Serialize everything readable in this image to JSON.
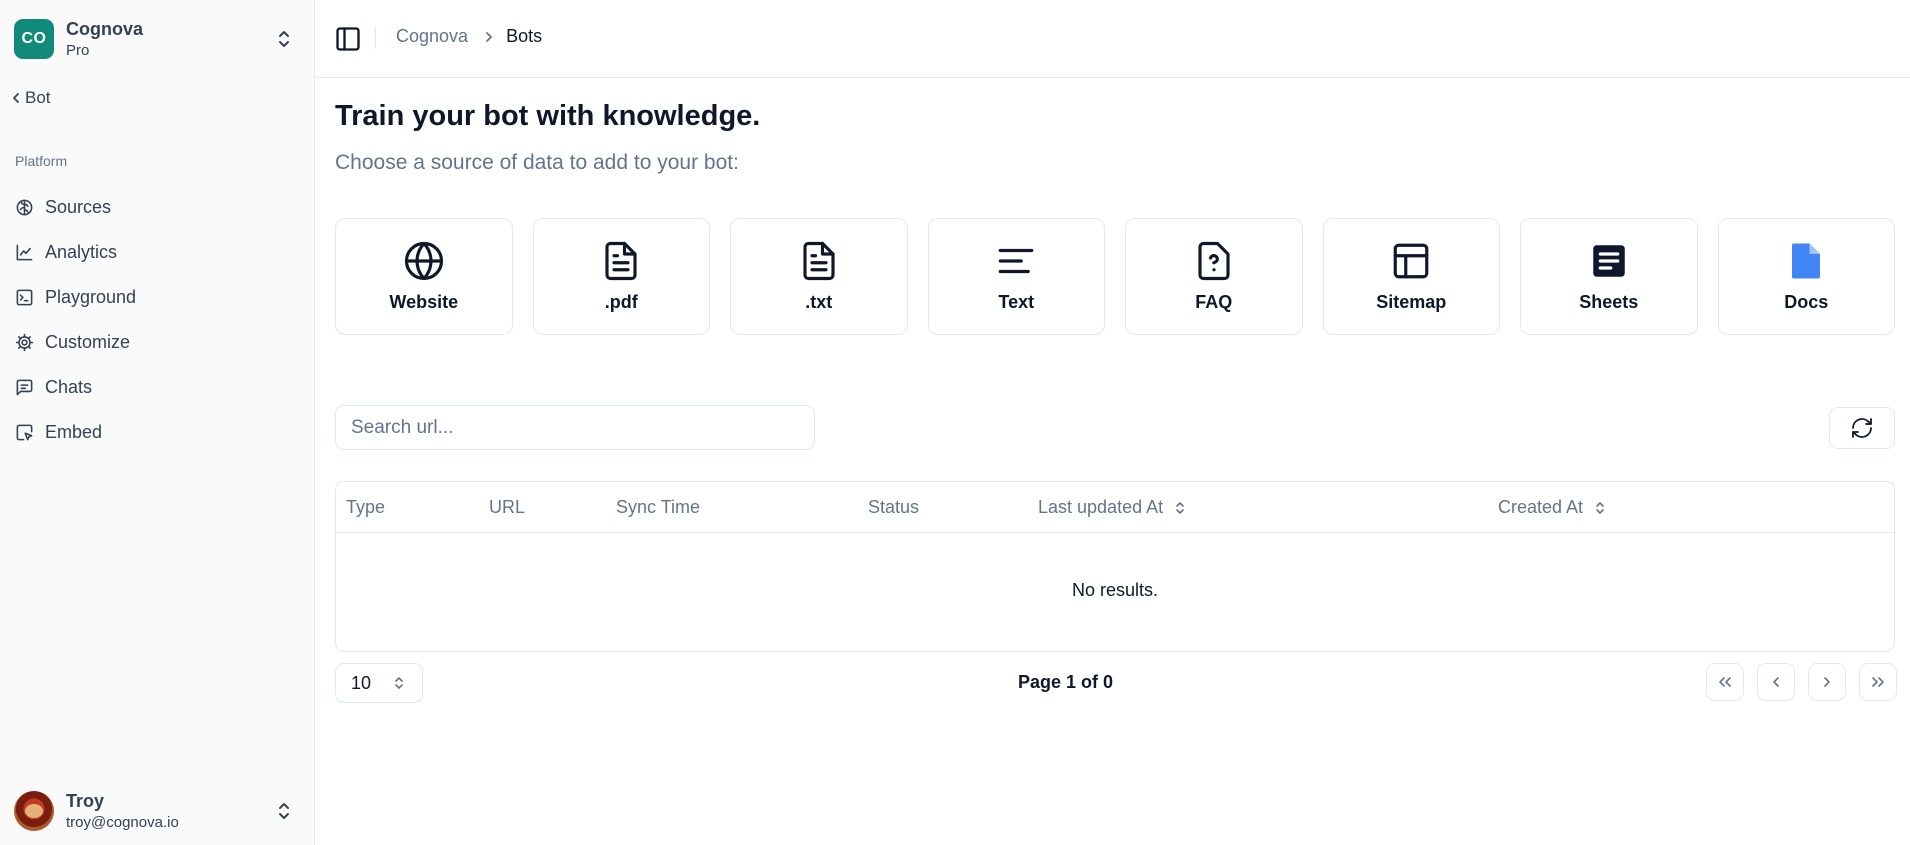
{
  "org": {
    "initials": "CO",
    "name": "Cognova",
    "plan": "Pro"
  },
  "back": {
    "label": "Bot"
  },
  "sidebar": {
    "section_label": "Platform",
    "items": [
      {
        "label": "Sources",
        "icon": "brain-icon"
      },
      {
        "label": "Analytics",
        "icon": "chart-line-icon"
      },
      {
        "label": "Playground",
        "icon": "terminal-icon"
      },
      {
        "label": "Customize",
        "icon": "cog-icon"
      },
      {
        "label": "Chats",
        "icon": "message-square-icon"
      },
      {
        "label": "Embed",
        "icon": "mouse-pointer-click-icon"
      }
    ]
  },
  "user": {
    "name": "Troy",
    "email": "troy@cognova.io"
  },
  "breadcrumb": {
    "root": "Cognova",
    "current": "Bots"
  },
  "main": {
    "title": "Train your bot with knowledge.",
    "subtitle": "Choose a source of data to add to your bot:"
  },
  "sources": [
    {
      "label": "Website",
      "icon": "globe-icon"
    },
    {
      "label": ".pdf",
      "icon": "file-text-icon"
    },
    {
      "label": ".txt",
      "icon": "file-text-icon"
    },
    {
      "label": "Text",
      "icon": "align-left-icon"
    },
    {
      "label": "FAQ",
      "icon": "file-question-icon"
    },
    {
      "label": "Sitemap",
      "icon": "layout-icon"
    },
    {
      "label": "Sheets",
      "icon": "sheets-icon"
    },
    {
      "label": "Docs",
      "icon": "docs-icon"
    }
  ],
  "search": {
    "placeholder": "Search url..."
  },
  "table": {
    "columns": [
      "Type",
      "URL",
      "Sync Time",
      "Status",
      "Last updated At",
      "Created At"
    ],
    "empty_text": "No results."
  },
  "pagination": {
    "page_size": "10",
    "page_info": "Page 1 of 0"
  },
  "colors": {
    "brand": "#128a7a",
    "docs_blue": "#4285f4",
    "muted": "#64748b"
  }
}
